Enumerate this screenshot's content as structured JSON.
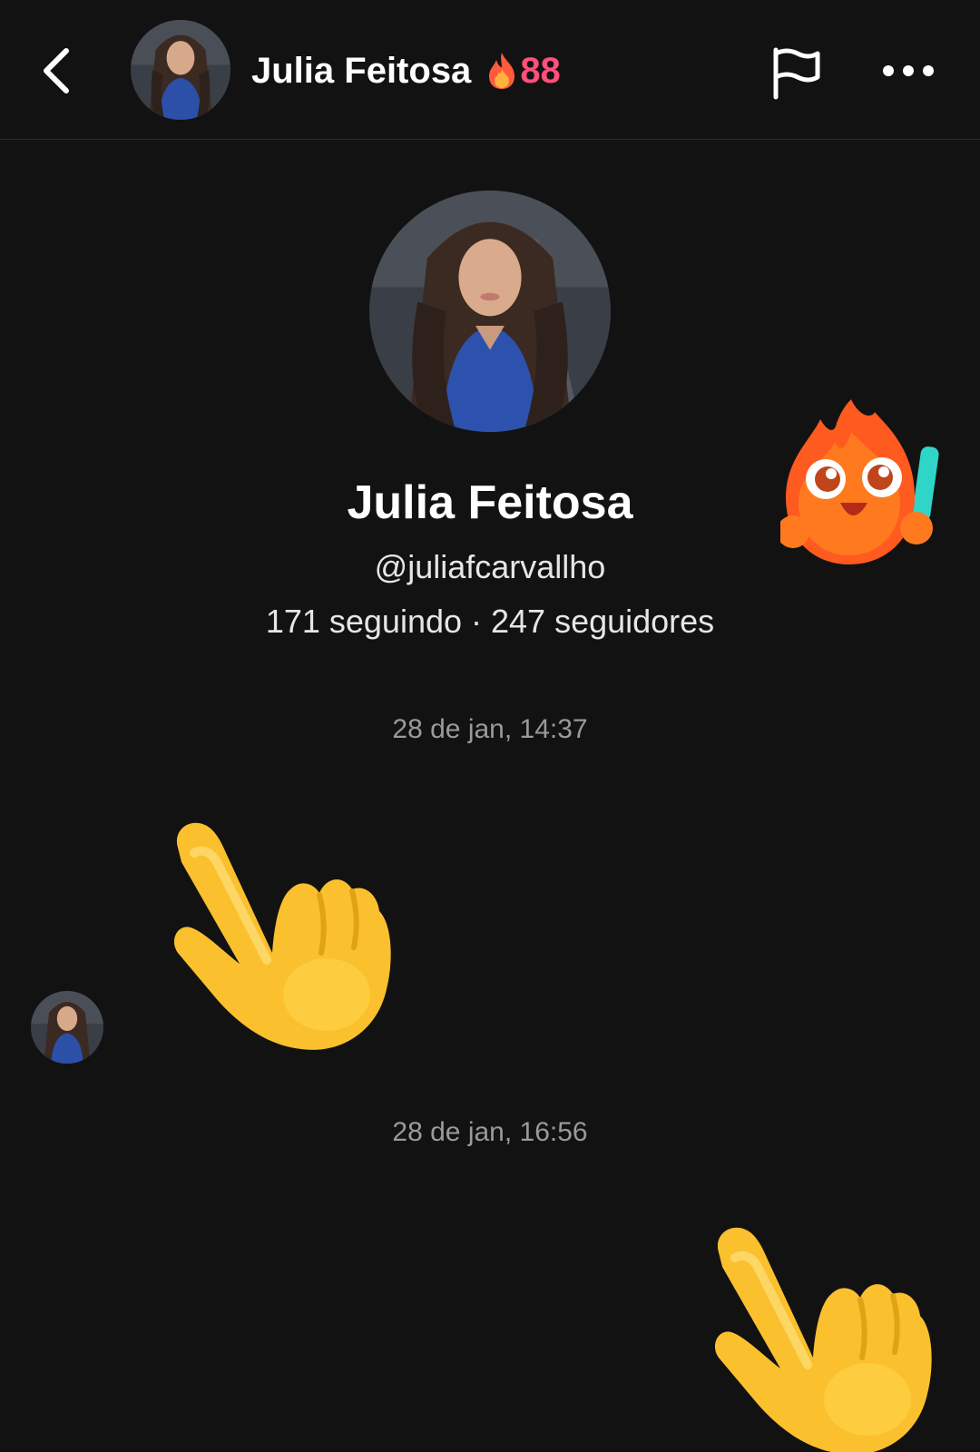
{
  "header": {
    "name": "Julia Feitosa",
    "streak_count": "88"
  },
  "profile": {
    "name": "Julia Feitosa",
    "handle": "@juliafcarvallho",
    "stats": "171 seguindo · 247 seguidores"
  },
  "messages": [
    {
      "timestamp": "28 de jan, 14:37",
      "from": "contact",
      "emoji": "backhand-index-pointing-down"
    },
    {
      "timestamp": "28 de jan, 16:56",
      "from": "me",
      "emoji": "backhand-index-pointing-down"
    }
  ],
  "icons": {
    "back": "chevron-left-icon",
    "flag": "flag-icon",
    "more": "more-horizontal-icon",
    "streak": "flame-icon",
    "sticker": "fire-mascot-sticker"
  },
  "colors": {
    "background": "#121213",
    "streak_accent": "#ff4f7a",
    "timestamp": "#9a9a9e",
    "divider": "#2a2a2c"
  }
}
